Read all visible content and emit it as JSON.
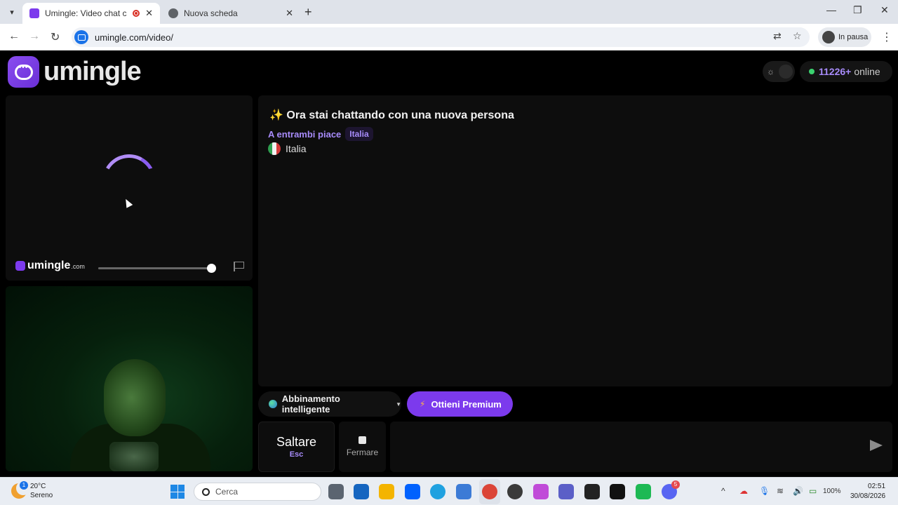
{
  "browser": {
    "tabs": [
      {
        "title": "Umingle: Video chat con sc",
        "active": true
      },
      {
        "title": "Nuova scheda",
        "active": false
      }
    ],
    "url": "umingle.com/video/",
    "profile_label": "In pausa"
  },
  "header": {
    "logo_text": "umingle",
    "online_count": "11226+",
    "online_label": "online"
  },
  "remote_video": {
    "watermark_text": "umingle",
    "watermark_domain": ".com",
    "volume_level": 1.0
  },
  "chat": {
    "title": "✨ Ora stai chattando con una nuova persona",
    "likes_label": "A entrambi piace",
    "likes_tag": "Italia",
    "country": "Italia"
  },
  "controls": {
    "match_label": "Abbinamento intelligente",
    "premium_label": "Ottieni Premium",
    "skip_label": "Saltare",
    "skip_key": "Esc",
    "stop_label": "Fermare",
    "message_placeholder": ""
  },
  "taskbar": {
    "weather_temp": "20°C",
    "weather_desc": "Sereno",
    "weather_badge": "1",
    "search_placeholder": "Cerca",
    "discord_badge": "5",
    "battery": "100%",
    "time": "02:51",
    "date": "30/08/2026"
  },
  "colors": {
    "accent": "#7c3aed",
    "accent_text": "#a78bfa",
    "online_dot": "#3bd16f"
  }
}
